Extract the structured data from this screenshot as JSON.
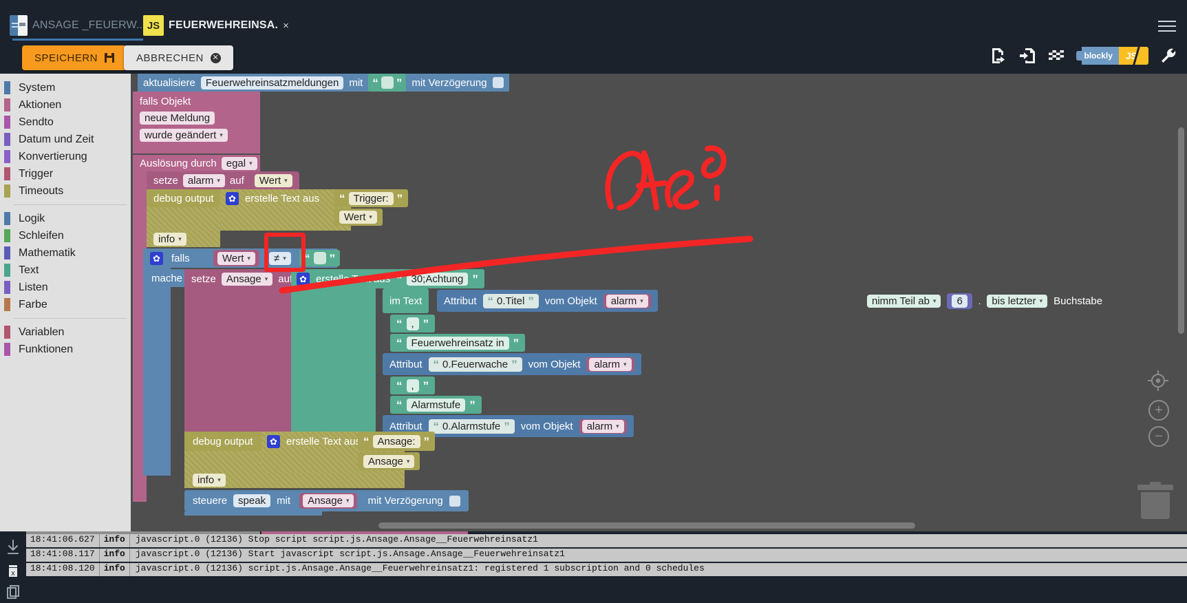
{
  "window": {
    "tabs": [
      {
        "label": "ANSAGE _FEUERW...",
        "icon": "script-icon",
        "close": "close-red-icon",
        "active": false
      },
      {
        "label": "FEUERWEHREINSA.",
        "icon": "js-icon",
        "close": "×",
        "active": true
      }
    ],
    "menu_icon": "hamburger-icon"
  },
  "toolbar": {
    "save_label": "SPEICHERN",
    "cancel_label": "ABBRECHEN",
    "icons": [
      "export-file-icon",
      "import-file-icon",
      "checkered-flag-icon",
      "wrench-icon"
    ],
    "mode_blockly": "blockly",
    "mode_js": "JS"
  },
  "toolbox": {
    "groups": [
      {
        "items": [
          {
            "label": "System",
            "color": "#4f7aa8"
          },
          {
            "label": "Aktionen",
            "color": "#b3648b"
          },
          {
            "label": "Sendto",
            "color": "#a955a9"
          },
          {
            "label": "Datum und Zeit",
            "color": "#7a5fc0"
          },
          {
            "label": "Konvertierung",
            "color": "#8a5fc9"
          },
          {
            "label": "Trigger",
            "color": "#b0566e"
          },
          {
            "label": "Timeouts",
            "color": "#a8a353"
          }
        ]
      },
      {
        "items": [
          {
            "label": "Logik",
            "color": "#4f7aa8"
          },
          {
            "label": "Schleifen",
            "color": "#57a85a"
          },
          {
            "label": "Mathematik",
            "color": "#5b5bb5"
          },
          {
            "label": "Text",
            "color": "#4aa58c"
          },
          {
            "label": "Listen",
            "color": "#7a5fc0"
          },
          {
            "label": "Farbe",
            "color": "#b5784e"
          }
        ]
      },
      {
        "items": [
          {
            "label": "Variablen",
            "color": "#b0566e"
          },
          {
            "label": "Funktionen",
            "color": "#a955a9"
          }
        ]
      }
    ]
  },
  "workspace": {
    "b_update": {
      "label": "aktualisiere",
      "object": "Feuerwehreinsatzmeldungen",
      "mit": "mit",
      "delay_label": "mit Verzögerung"
    },
    "b_trigger": {
      "title": "falls Objekt",
      "object": "neue Meldung",
      "condition": "wurde geändert",
      "source_label": "Auslösung durch",
      "source_value": "egal"
    },
    "b_set_alarm": {
      "set": "setze",
      "var": "alarm",
      "auf": "auf",
      "value": "Wert"
    },
    "b_debug1": {
      "label": "debug output",
      "create_text": "erstelle Text aus",
      "text1": "Trigger:",
      "text2": "Wert",
      "level": "info"
    },
    "b_if": {
      "label": "falls",
      "left": "Wert",
      "operator": "≠",
      "mache": "mache"
    },
    "b_set_ansage": {
      "set": "setze",
      "var": "Ansage",
      "auf": "auf",
      "create_text": "erstelle Text aus"
    },
    "join_items": [
      {
        "kind": "text",
        "value": "30;Achtung"
      },
      {
        "kind": "substring",
        "im_text": "im Text",
        "attribut": "Attribut",
        "attr_name": "0.Titel",
        "vom_objekt": "vom Objekt",
        "objekt": "alarm",
        "from": "nimm Teil ab",
        "index": "6",
        "dot": ".",
        "to": "bis letzter",
        "buchstabe": "Buchstabe"
      },
      {
        "kind": "text",
        "value": ","
      },
      {
        "kind": "text",
        "value": "Feuerwehreinsatz in"
      },
      {
        "kind": "attribute",
        "attribut": "Attribut",
        "attr_name": "0.Feuerwache",
        "vom_objekt": "vom Objekt",
        "objekt": "alarm"
      },
      {
        "kind": "text",
        "value": ","
      },
      {
        "kind": "text",
        "value": "Alarmstufe"
      },
      {
        "kind": "attribute",
        "attribut": "Attribut",
        "attr_name": "0.Alarmstufe",
        "vom_objekt": "vom Objekt",
        "objekt": "alarm"
      }
    ],
    "b_debug2": {
      "label": "debug output",
      "create_text": "erstelle Text aus",
      "text1": "Ansage:",
      "text2": "Ansage",
      "level": "info"
    },
    "b_speak": {
      "steuere": "steuere",
      "target": "speak",
      "mit": "mit",
      "value": "Ansage",
      "delay_label": "mit Verzögerung"
    },
    "annotation": "Das?",
    "controls": {
      "center": "center-target-icon",
      "zoom_in": "+",
      "zoom_out": "−",
      "trash": "trash-icon"
    }
  },
  "log": {
    "gutter_icons": [
      "download-arrow-icon",
      "clear-log-icon",
      "copy-icon"
    ],
    "rows": [
      {
        "time": "18:41:06.627",
        "level": "info",
        "message": "javascript.0 (12136) Stop script script.js.Ansage.Ansage__Feuerwehreinsatz1"
      },
      {
        "time": "18:41:08.117",
        "level": "info",
        "message": "javascript.0 (12136) Start javascript script.js.Ansage.Ansage__Feuerwehreinsatz1"
      },
      {
        "time": "18:41:08.120",
        "level": "info",
        "message": "javascript.0 (12136) script.js.Ansage.Ansage__Feuerwehreinsatz1: registered 1 subscription and 0 schedules"
      }
    ]
  }
}
